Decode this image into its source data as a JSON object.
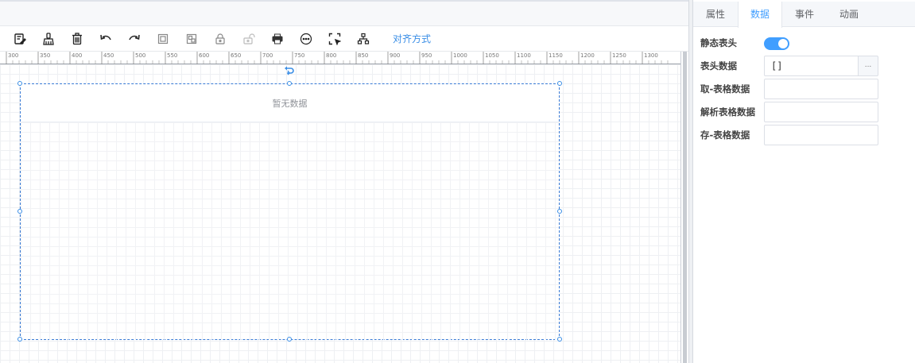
{
  "toolbar": {
    "icons": [
      "edit-icon",
      "format-brush-icon",
      "trash-icon",
      "undo-icon",
      "redo-icon",
      "copy-icon",
      "paste-icon",
      "lock-icon",
      "unlock-icon",
      "printer-icon",
      "circle-more-icon",
      "select-area-icon",
      "hierarchy-icon"
    ],
    "align_label": "对齐方式"
  },
  "ruler": {
    "labels": [
      "300",
      "350",
      "400",
      "450",
      "500",
      "550",
      "600",
      "650",
      "700",
      "750",
      "800",
      "850",
      "900",
      "950",
      "1000",
      "1050",
      "1100",
      "1150",
      "1200",
      "1250",
      "1300"
    ]
  },
  "widget": {
    "empty_text": "暂无数据"
  },
  "panel": {
    "tabs": [
      {
        "label": "属性",
        "active": false
      },
      {
        "label": "数据",
        "active": true
      },
      {
        "label": "事件",
        "active": false
      },
      {
        "label": "动画",
        "active": false
      }
    ],
    "fields": {
      "static_header_label": "静态表头",
      "static_header_on": true,
      "header_data_label": "表头数据",
      "header_data_value": "[]",
      "header_data_button": "...",
      "get_table_label": "取-表格数据",
      "get_table_value": "",
      "parse_table_label": "解析表格数据",
      "parse_table_value": "",
      "save_table_label": "存-表格数据",
      "save_table_value": ""
    }
  },
  "colors": {
    "accent": "#409eff",
    "selection": "#3a7bd5"
  }
}
